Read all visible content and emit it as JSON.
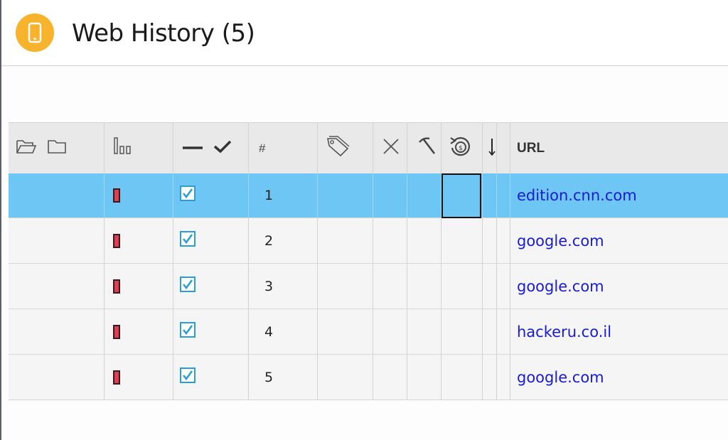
{
  "header": {
    "title": "Web History (5)",
    "icon": "phone-icon",
    "accent": "#f6b32b"
  },
  "table": {
    "columns": [
      {
        "key": "folder",
        "icons": [
          "open-folder-icon",
          "folder-icon"
        ]
      },
      {
        "key": "bars",
        "icon": "bars-icon"
      },
      {
        "key": "check",
        "icons": [
          "dash-icon",
          "checkmark-icon"
        ]
      },
      {
        "key": "number",
        "label": "#"
      },
      {
        "key": "tag",
        "icon": "tag-icon"
      },
      {
        "key": "delete",
        "icon": "x-icon"
      },
      {
        "key": "carve",
        "icon": "pickaxe-icon"
      },
      {
        "key": "recover",
        "icon": "restore-icon"
      },
      {
        "key": "sort",
        "icon": "arrow-down-icon"
      },
      {
        "key": "url",
        "label": "URL"
      }
    ],
    "rows": [
      {
        "number": "1",
        "url": "edition.cnn.com",
        "checked": true,
        "selected": true
      },
      {
        "number": "2",
        "url": "google.com",
        "checked": true,
        "selected": false
      },
      {
        "number": "3",
        "url": "google.com",
        "checked": true,
        "selected": false
      },
      {
        "number": "4",
        "url": "hackeru.co.il",
        "checked": true,
        "selected": false
      },
      {
        "number": "5",
        "url": "google.com",
        "checked": true,
        "selected": false
      }
    ],
    "colors": {
      "selected_row": "#6ec6f5",
      "link": "#1a1ad6",
      "status_chip": "#de3d52",
      "checkbox": "#2a9fd6"
    }
  }
}
